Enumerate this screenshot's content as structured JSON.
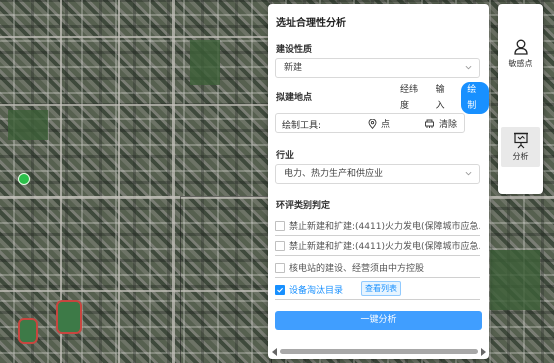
{
  "panel": {
    "title": "选址合理性分析",
    "construction": {
      "label": "建设性质",
      "value": "新建"
    },
    "location": {
      "label": "拟建地点",
      "tabs": [
        {
          "label": "经纬度",
          "active": false
        },
        {
          "label": "输入",
          "active": false
        },
        {
          "label": "绘制",
          "active": true
        }
      ],
      "draw_tools_label": "绘制工具:",
      "point_label": "点",
      "clear_label": "清除"
    },
    "industry": {
      "label": "行业",
      "value": "电力、热力生产和供应业"
    },
    "env_judgement": {
      "label": "环评类别判定",
      "items": [
        {
          "text": "禁止新建和扩建:(4411)火力发电(保障城市应急...",
          "checked": false
        },
        {
          "text": "禁止新建和扩建:(4411)火力发电(保障城市应急...",
          "checked": false
        },
        {
          "text": "核电站的建设、经营须由中方控股",
          "checked": false
        },
        {
          "text": "设备淘汰目录",
          "checked": true,
          "button": "查看列表"
        }
      ]
    },
    "analyze_button": "一键分析"
  },
  "rail": {
    "sensitive_label": "敏感点",
    "analysis_label": "分析"
  },
  "colors": {
    "accent": "#1890ff",
    "button": "#409eff",
    "map_pin": "#2bbf4a"
  },
  "icons": {
    "point": "location-pin-icon",
    "clear": "eraser-icon",
    "sensitive": "person-pin-icon",
    "analysis": "presentation-board-icon"
  }
}
